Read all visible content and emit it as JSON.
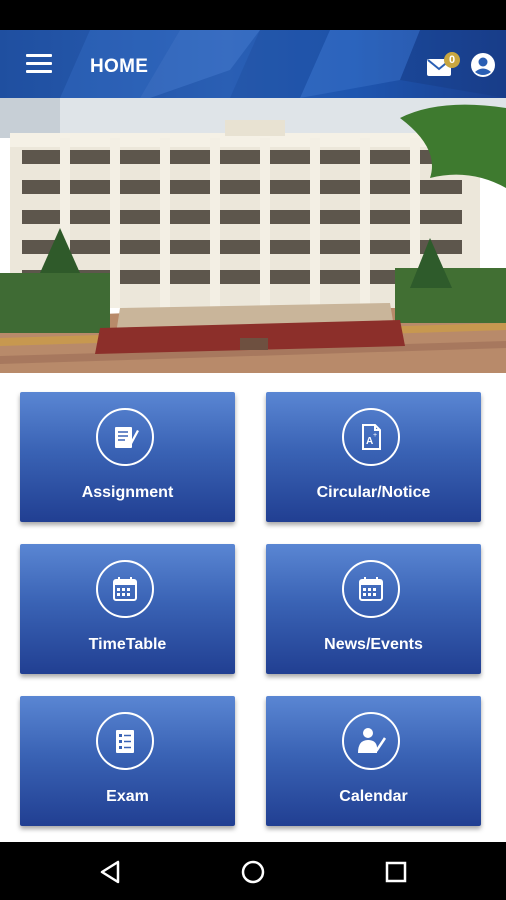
{
  "appbar": {
    "title": "HOME",
    "mail_badge": "0"
  },
  "menu_tiles": [
    {
      "label": "Assignment",
      "icon": "assignment-icon"
    },
    {
      "label": "Circular/Notice",
      "icon": "circular-notice-icon"
    },
    {
      "label": "TimeTable",
      "icon": "timetable-icon"
    },
    {
      "label": "News/Events",
      "icon": "news-events-icon"
    },
    {
      "label": "Exam",
      "icon": "exam-icon"
    },
    {
      "label": "Calendar",
      "icon": "calendar-teacher-icon"
    }
  ],
  "colors": {
    "appbar": "#2a5fb4",
    "tile_top": "#5a86d3",
    "tile_bottom": "#213f92",
    "badge": "#c8a640"
  }
}
